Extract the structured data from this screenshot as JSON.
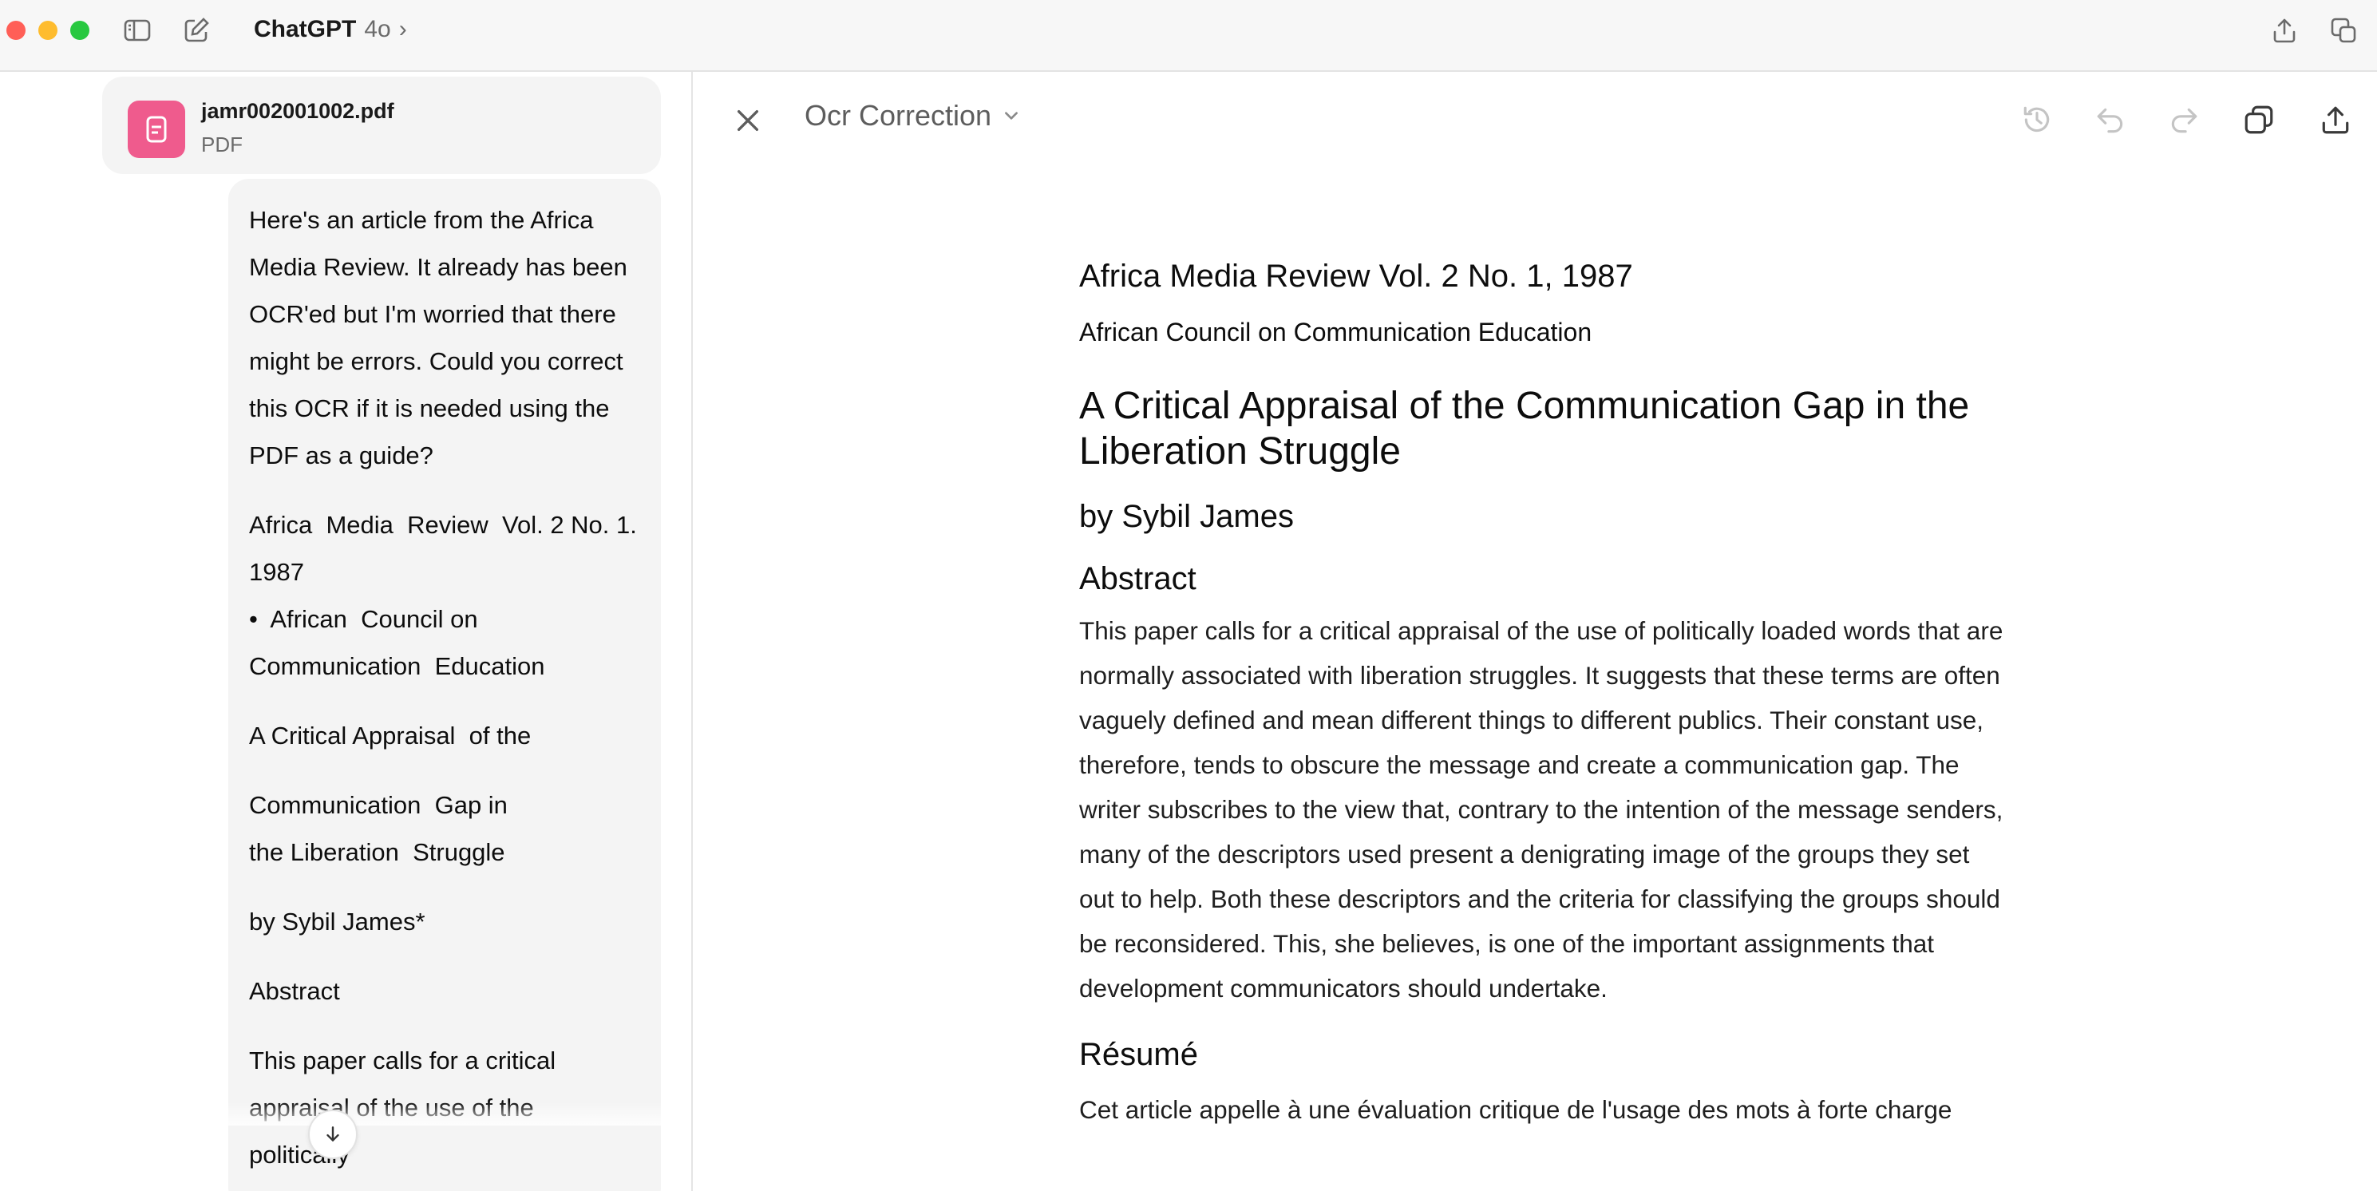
{
  "titlebar": {
    "app_name": "ChatGPT",
    "model": "4o",
    "chevron": "›"
  },
  "attachment": {
    "file_name": "jamr002001002.pdf",
    "file_type": "PDF",
    "icon": "document-icon",
    "icon_color": "#ef5b8d"
  },
  "user_message": {
    "paragraphs": [
      "Here's an article from the Africa Media Review. It already has been OCR'ed but I'm worried that there might be errors. Could you correct this OCR if it is needed using the PDF as a guide?",
      "Africa  Media  Review  Vol. 2 No. 1.  1987",
      "•  African  Council on Communication  Education",
      "A Critical Appraisal  of the",
      "Communication  Gap in the Liberation  Struggle",
      "by Sybil James*",
      "Abstract",
      "This paper calls for a critical appraisal of the use of the politically"
    ]
  },
  "canvas": {
    "doc_title": "Ocr Correction",
    "journal": "Africa Media Review Vol. 2 No. 1, 1987",
    "council": "African Council on Communication Education",
    "article_title": "A Critical Appraisal of the Communication Gap in the Liberation Struggle",
    "author": "by Sybil James",
    "abstract_heading": "Abstract",
    "abstract_body": "This paper calls for a critical appraisal of the use of politically loaded words that are normally associated with liberation struggles. It suggests that these terms are often vaguely defined and mean different things to different publics. Their constant use, therefore, tends to obscure the message and create a communication gap. The writer subscribes to the view that, contrary to the intention of the message senders, many of the descriptors used present a denigrating image of the groups they set out to help. Both these descriptors and the criteria for classifying the groups should be reconsidered. This, she believes, is one of the important assignments that development communicators should undertake.",
    "resume_heading": "Résumé",
    "resume_body": "Cet article appelle à une évaluation critique de l'usage des mots à forte charge"
  },
  "colors": {
    "titlebar_bg": "#f7f7f7",
    "bubble_bg": "#f4f4f4",
    "accent_pdf": "#ef5b8d"
  }
}
